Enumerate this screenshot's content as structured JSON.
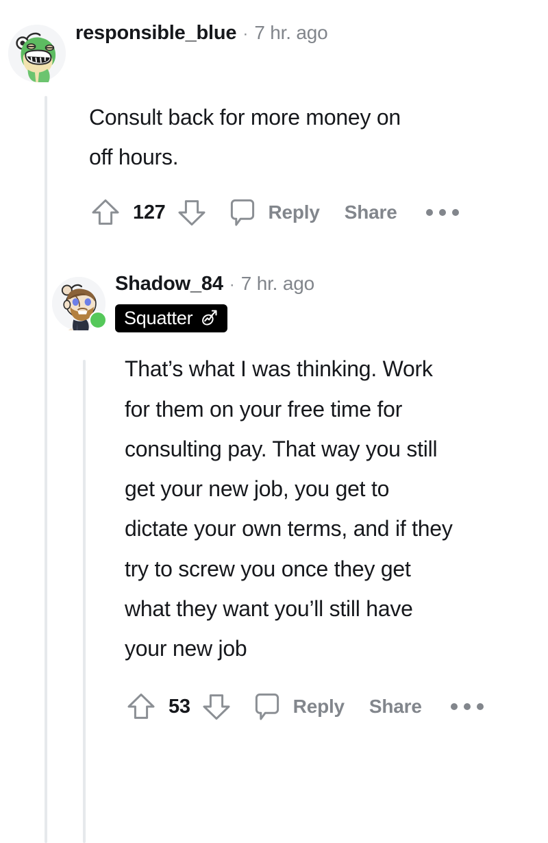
{
  "theme": {
    "background": "#ffffff",
    "text_primary": "#16181c",
    "text_meta": "#81858b",
    "action_gray": "#82868c",
    "thread_line": "#e6e9ec",
    "badge_bg": "#000000",
    "badge_text": "#ffffff",
    "online_dot": "#55c85a"
  },
  "comments": [
    {
      "id": "comment-top",
      "depth": 1,
      "author": "responsible_blue",
      "separator": "·",
      "timestamp": "7 hr. ago",
      "avatar": "snoo-green-dino-avatar",
      "online": false,
      "badge": null,
      "body": "Consult back for more money on off hours.",
      "actions": {
        "upvote_icon": "upvote-arrow-icon",
        "score": "127",
        "downvote_icon": "downvote-arrow-icon",
        "comment_icon": "speech-bubble-icon",
        "reply_label": "Reply",
        "share_label": "Share",
        "overflow_icon": "overflow-dots-icon"
      }
    },
    {
      "id": "comment-reply",
      "depth": 2,
      "author": "Shadow_84",
      "separator": "·",
      "timestamp": "7 hr. ago",
      "avatar": "snoo-bearded-avatar",
      "online": true,
      "badge": {
        "label": "Squatter",
        "icon": "trending-up-circle-icon"
      },
      "body": "That’s what I was thinking. Work for them on your free time for consulting pay. That way you still get your new job, you get to dictate your own terms, and if they try to screw you once they get what they want you’ll still have your new job",
      "actions": {
        "upvote_icon": "upvote-arrow-icon",
        "score": "53",
        "downvote_icon": "downvote-arrow-icon",
        "comment_icon": "speech-bubble-icon",
        "reply_label": "Reply",
        "share_label": "Share",
        "overflow_icon": "overflow-dots-icon"
      }
    }
  ]
}
